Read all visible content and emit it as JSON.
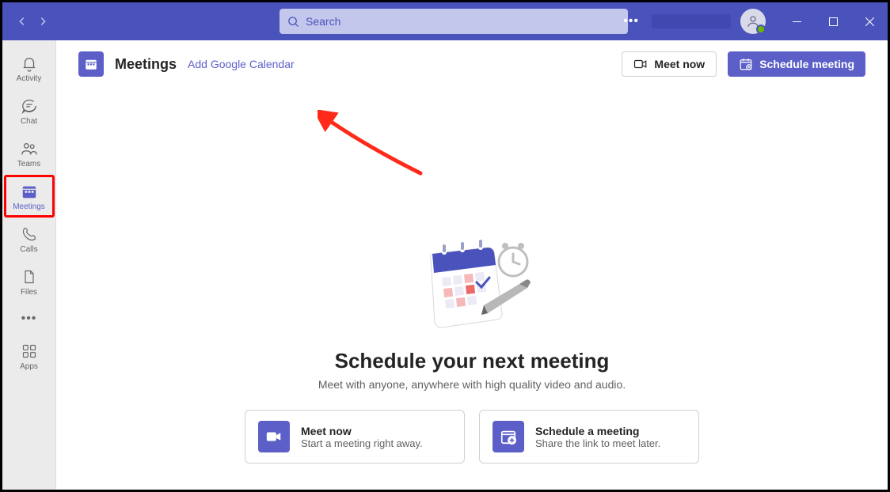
{
  "titlebar": {
    "search_placeholder": "Search"
  },
  "sidebar": {
    "items": [
      {
        "label": "Activity"
      },
      {
        "label": "Chat"
      },
      {
        "label": "Teams"
      },
      {
        "label": "Meetings"
      },
      {
        "label": "Calls"
      },
      {
        "label": "Files"
      },
      {
        "label": "Apps"
      }
    ]
  },
  "header": {
    "title": "Meetings",
    "link": "Add Google Calendar",
    "meet_now_btn": "Meet now",
    "schedule_btn": "Schedule meeting"
  },
  "hero": {
    "title": "Schedule your next meeting",
    "subtitle": "Meet with anyone, anywhere with high quality video and audio."
  },
  "cards": [
    {
      "title": "Meet now",
      "sub": "Start a meeting right away."
    },
    {
      "title": "Schedule a meeting",
      "sub": "Share the link to meet later."
    }
  ],
  "colors": {
    "brand": "#5b5fc7",
    "titlebar": "#4a53bc"
  }
}
